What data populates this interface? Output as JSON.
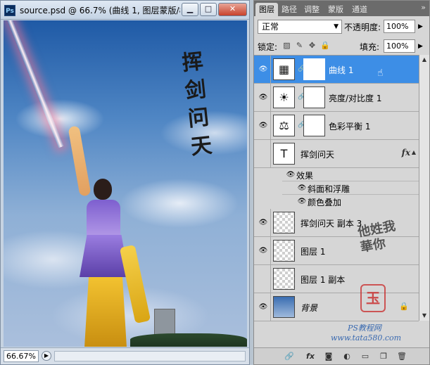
{
  "document": {
    "app_icon": "Ps",
    "title": "source.psd @ 66.7% (曲线 1, 图层蒙版/8...",
    "window_buttons": {
      "minimize": "▁",
      "maximize": "□",
      "close": "✕"
    },
    "canvas_text": "挥剑问天",
    "zoom": "66.67%"
  },
  "panel": {
    "tabs": [
      "图层",
      "路径",
      "调整",
      "蒙版",
      "通道"
    ],
    "active_tab": "图层",
    "menu_icon": "»",
    "blend_mode": "正常",
    "opacity_label": "不透明度:",
    "opacity_value": "100%",
    "lock_label": "锁定:",
    "fill_label": "填充:",
    "fill_value": "100%",
    "layers": [
      {
        "name": "曲线 1",
        "type": "adjustment",
        "icon": "curves-icon",
        "glyph": "▦",
        "selected": true,
        "mask": true
      },
      {
        "name": "亮度/对比度 1",
        "type": "adjustment",
        "icon": "brightness-contrast-icon",
        "glyph": "☀",
        "mask": true
      },
      {
        "name": "色彩平衡 1",
        "type": "adjustment",
        "icon": "color-balance-icon",
        "glyph": "⚖",
        "mask": true
      },
      {
        "name": "挥剑问天",
        "type": "text",
        "glyph": "T",
        "fx": "fx"
      },
      {
        "name": "斜面和浮雕",
        "type": "effect"
      },
      {
        "name": "颜色叠加",
        "type": "effect"
      },
      {
        "name": "挥剑问天 副本 3",
        "type": "pixel"
      },
      {
        "name": "图层 1",
        "type": "pixel"
      },
      {
        "name": "图层 1 副本",
        "type": "pixel"
      },
      {
        "name": "背景",
        "type": "background",
        "locked": true
      }
    ],
    "effects_label": "效果",
    "watermark": {
      "calligraphy": "他姓我\n華你",
      "seal": "玉",
      "line1": "PS教程网",
      "line2": "www.tata580.com"
    }
  },
  "colors": {
    "selected_layer": "#3d8ee6",
    "panel_bg": "#d6d6d6",
    "tab_bar": "#6b6b6b"
  }
}
